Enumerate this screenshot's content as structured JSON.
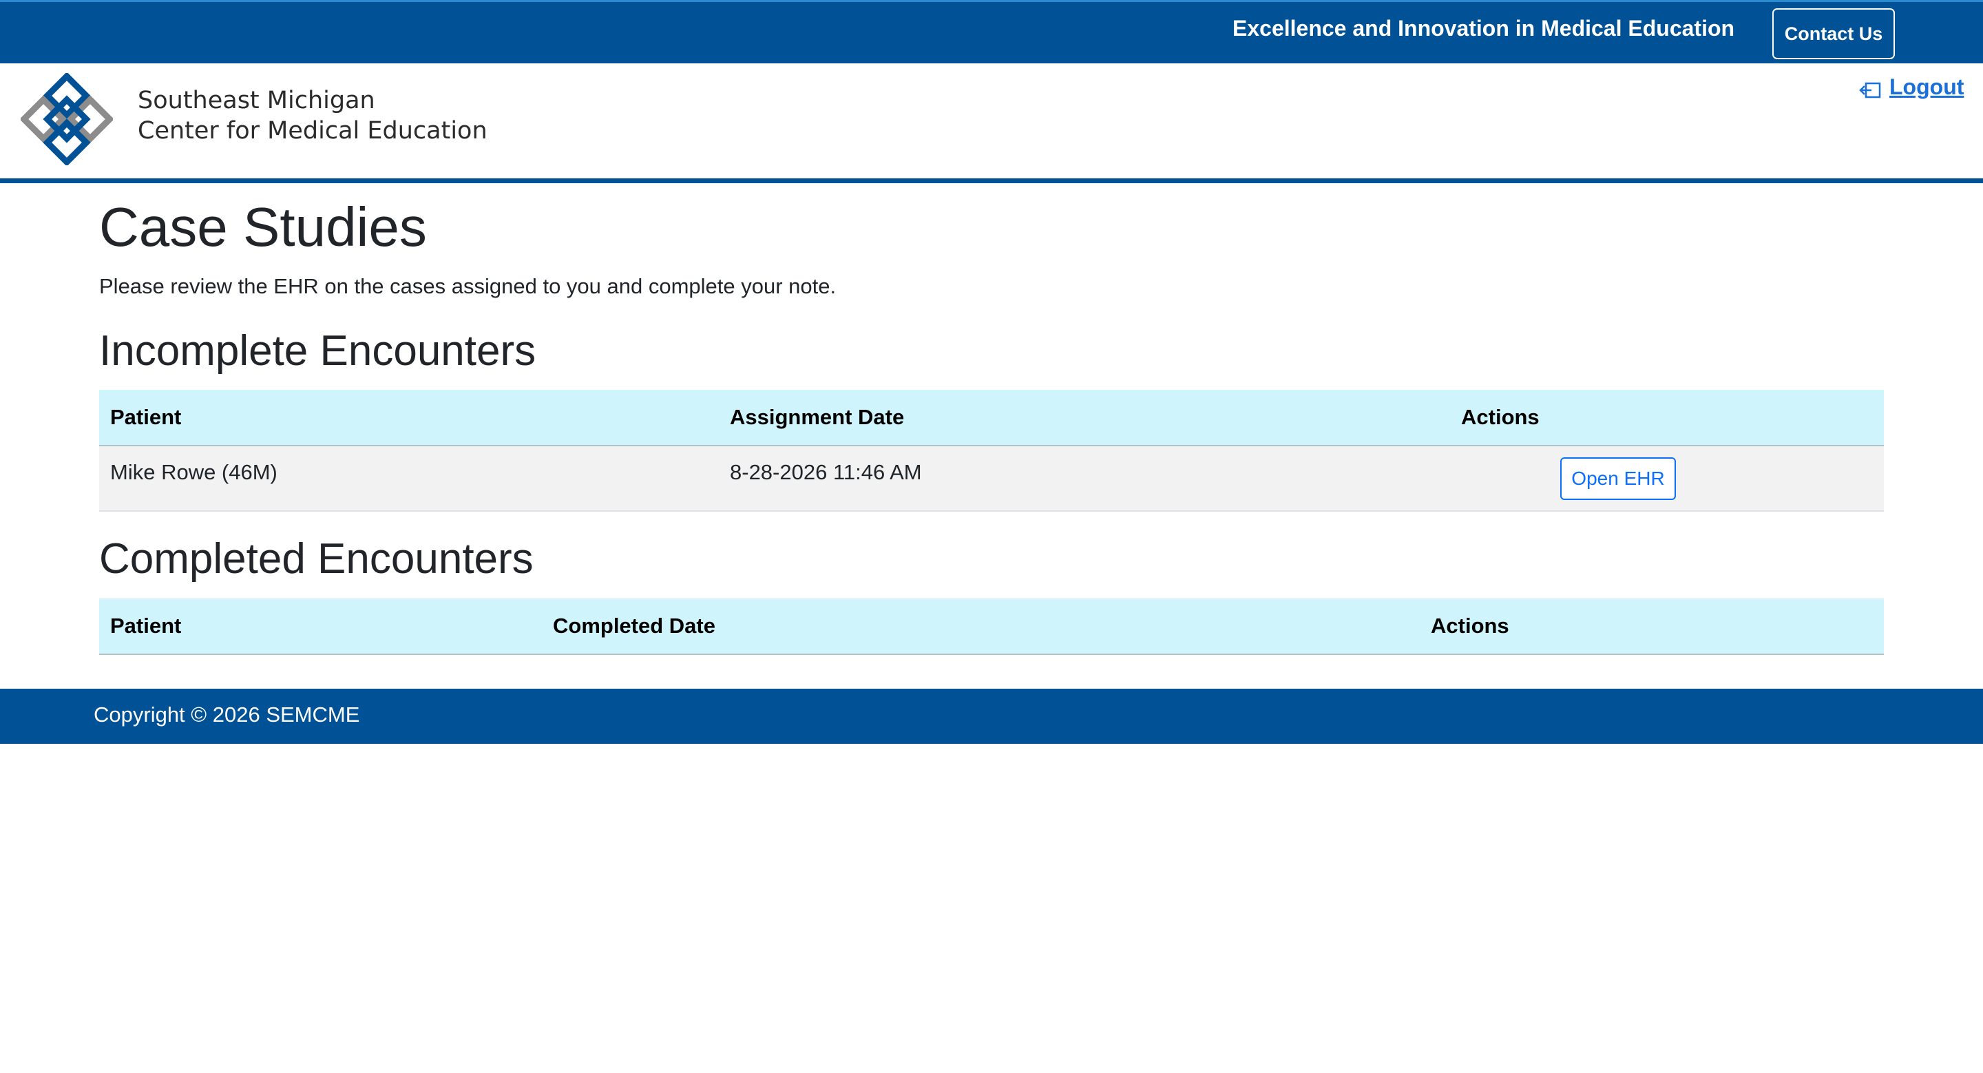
{
  "topbar": {
    "tagline": "Excellence and Innovation in Medical Education",
    "contact_label": "Contact Us",
    "background_color": "#005195"
  },
  "header": {
    "org_line1": "Southeast Michigan",
    "org_line2": "Center for Medical Education",
    "logout_label": "Logout",
    "logout_icon": "logout-arrow-icon",
    "logo_icon": "interlocked-diamonds-logo"
  },
  "main": {
    "title": "Case Studies",
    "intro": "Please review the EHR on the cases assigned to you and complete your note.",
    "incomplete": {
      "title": "Incomplete Encounters",
      "columns": [
        "Patient",
        "Assignment Date",
        "Actions"
      ],
      "rows": [
        {
          "patient": "Mike Rowe (46M)",
          "date": "8-28-2026 11:46 AM",
          "action_label": "Open EHR"
        }
      ]
    },
    "completed": {
      "title": "Completed Encounters",
      "columns": [
        "Patient",
        "Completed Date",
        "Actions"
      ],
      "rows": []
    }
  },
  "footer": {
    "copyright": "Copyright © 2026 SEMCME"
  },
  "colors": {
    "brand_blue": "#005195",
    "table_header": "#cff4fc",
    "link_blue": "#0d6efd"
  }
}
